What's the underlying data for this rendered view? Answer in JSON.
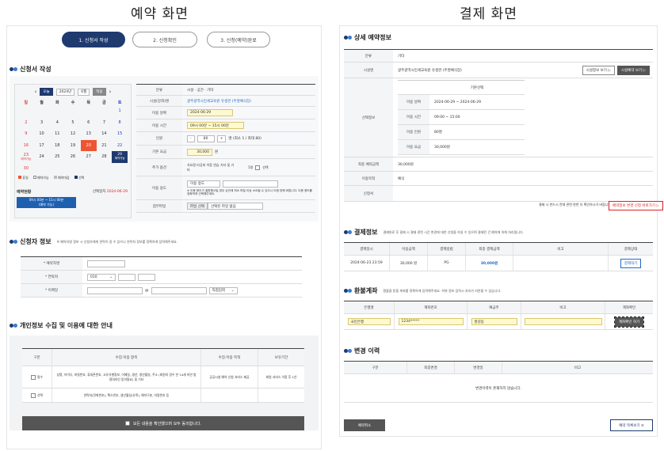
{
  "titles": {
    "left": "예약 화면",
    "right": "결제 화면"
  },
  "steps": [
    "1. 신청서 작성",
    "2. 신청확인",
    "3. 신청(예약)완료"
  ],
  "left": {
    "sec1": "신청서 작성",
    "cal": {
      "today_btn": "오늘",
      "year": "2024년",
      "month": "6월",
      "go_btn": "적용",
      "days": [
        "일",
        "월",
        "화",
        "수",
        "목",
        "금",
        "토"
      ],
      "cells": [
        "",
        "",
        "",
        "",
        "",
        "",
        "1",
        "2",
        "3",
        "4",
        "5",
        "6",
        "7",
        "8",
        "9",
        "10",
        "11",
        "12",
        "13",
        "14",
        "15",
        "16",
        "17",
        "18",
        "19",
        "20",
        "21",
        "22",
        "23",
        "24",
        "25",
        "26",
        "27",
        "28",
        "29",
        "30"
      ],
      "sel_sub": "예약가능",
      "sub23": "예약가능",
      "legend": [
        "휴일",
        "예약가능",
        "예약마감",
        "선택"
      ]
    },
    "booking_status": {
      "label": "예약현황",
      "date_label": "선택일자",
      "date": "2024-06-29",
      "slot": "09시 00분 ~ 15시 00분\n(예약 가능)"
    },
    "form": [
      {
        "label": "분류",
        "value": "시설 · 공간 · 기타"
      },
      {
        "label": "시설(강좌)명",
        "value": "광주광역시민세교육원 유생관 (주명예식장)"
      },
      {
        "label": "이용 날짜",
        "value": "2024-06-29"
      },
      {
        "label": "이용 시간",
        "value": "09시 00분 ~ 15시 00분"
      },
      {
        "label": "인원",
        "minus": "-",
        "count": "80",
        "plus": "+",
        "suffix": "명 (최소 1 / 최대 80)"
      },
      {
        "label": "기본 요금",
        "value": "30,000",
        "unit": "원"
      },
      {
        "label": "추가 옵션",
        "value": "가요정 타공비 이동 연습 기타 및 기타",
        "opt2": "1명",
        "opt3": "선택"
      },
      {
        "label": "이용 용도",
        "select": "이용 용도",
        "note": "※ 이용 용도가 결혼행사일 경우 승인에 최소 며칠 이상 소요될 수 있으니 이점 양해 바랍니다. 이용 용도를 정확하게 선택해주세요."
      },
      {
        "label": "첨부파일",
        "btn": "파일 선택",
        "value": "선택된 파일 없음"
      }
    ],
    "sec2": "신청자 정보",
    "sec2_note": "※ 예약자명 정보 시 신청자에게 연락이 갈 수 있으니 연락처 정보를 정확하게 입력해주세요.",
    "applicant": [
      {
        "label": "* 예약자명"
      },
      {
        "label": "* 연락처",
        "sel": "010"
      },
      {
        "label": "* 이메일",
        "at": "@",
        "sel": "직접입력"
      }
    ],
    "sec3": "개인정보 수집 및 이용에 대한 안내",
    "privacy": {
      "headers": [
        "구분",
        "수집·이용 항목",
        "수집·이용 목적",
        "보유기간"
      ],
      "rows": [
        {
          "type": "필수",
          "items": "성명, 아이디, 비밀번호, 휴대폰번호, 고유식별정보, 이메일, 생년, 생년월일, 주소 (회원의 경우 만 14세 미만 법정대리인 동의필요) 및 기타",
          "purpose": "공공시설 예약 신청 서비스 제공",
          "period": "회원 서비스 이용 후 1년"
        },
        {
          "type": "선택",
          "items": "연락처(전화번호), 팩스번호, 생년월일(유족), 예약구분, 차량번호 등",
          "purpose": "",
          "period": ""
        }
      ],
      "agree": "모든 내용을 확인했으며 모두 동의합니다."
    }
  },
  "right": {
    "sec1": "상세 예약정보",
    "detail": [
      {
        "label": "분류",
        "value": "기타"
      },
      {
        "label": "시설명",
        "value": "광주광역시민세교육원 유생관 (주명예식장)",
        "btn1": "시설정보 보기 ▷",
        "btn2": "시설예약 보기 ▷"
      }
    ],
    "sel_label": "선택정보",
    "sel_head": "기본선택",
    "sel_rows": [
      {
        "k": "이용 날짜",
        "v": "2024-06-29 ~ 2024-06-29"
      },
      {
        "k": "이용 시간",
        "v": "09:00 ~ 15:00"
      },
      {
        "k": "이용 인원",
        "v": "80명"
      },
      {
        "k": "이용 요금",
        "v": "30,000원"
      }
    ],
    "detail2": [
      {
        "label": "최종 예약금액",
        "value": "30,000원"
      },
      {
        "label": "이용목적",
        "value": "예식"
      },
      {
        "label": "신청서",
        "value": ""
      }
    ],
    "change_note": "결제 시 반드시 전체 관련 한번 더 확인하시기 바랍니다.",
    "change_btn": "예약정보 변경 신청 바로가기 ▷",
    "sec2": "결제정보",
    "sec2_note": "결제완료 후 결제 시 결제 관련 시간 변경에 대한 신청을 하실 수 있으며 결제된 건 예약에 의해 처리됩니다.",
    "pay": {
      "headers": [
        "결제일시",
        "이용금액",
        "결제방법",
        "최종 결제금액",
        "비고",
        "결제상태"
      ],
      "row": [
        "2024-06-23 23:59",
        "30,000 원",
        "PG",
        "30,000원",
        "",
        "결제대기"
      ]
    },
    "sec3": "환불계좌",
    "sec3_note": "환불을 받을 계좌를 정확하게 입력해주세요. 허위 정보 입력시 처리가 지연될 수 있습니다.",
    "refund": {
      "headers": [
        "은행명",
        "계좌번호",
        "예금주",
        "비고",
        "계좌확인"
      ],
      "row": [
        "국민은행",
        "1234*****",
        "홍길동",
        "",
        "계좌확인 하기"
      ]
    },
    "sec4": "변경 이력",
    "hist": {
      "headers": [
        "구분",
        "최종변경",
        "변경일",
        "비고"
      ],
      "empty": "변경이력이 존재하지 않습니다."
    },
    "cancel_btn": "예약취소",
    "list_btn": "예약 목록보기 ≡"
  }
}
